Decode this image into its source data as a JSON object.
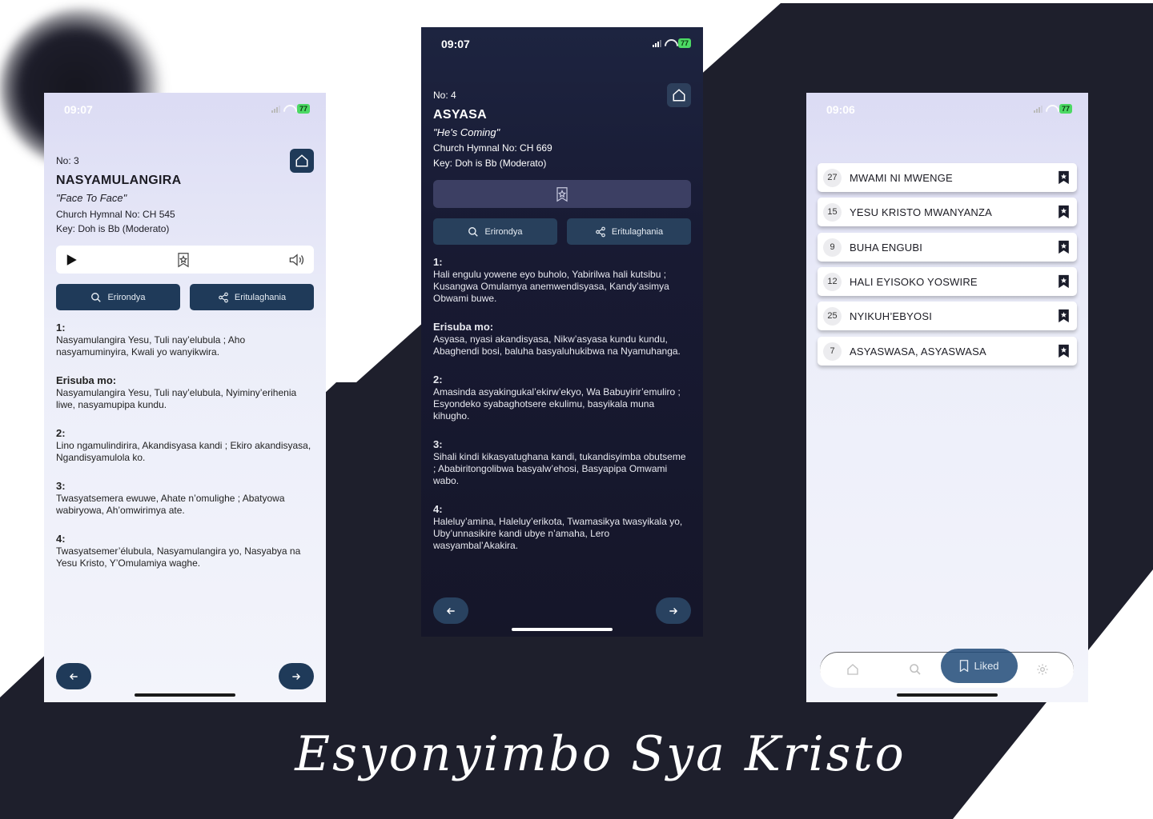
{
  "headline": "Esyonyimbo Sya Kristo",
  "colors": {
    "background_dark": "#1e1f2c",
    "accent": "#1f3a59",
    "battery": "#4cd964"
  },
  "left_screen": {
    "status_time": "09:07",
    "battery": "77",
    "hymn_no": "No: 3",
    "title": "NASYAMULANGIRA",
    "english_title": "\"Face To Face\"",
    "church_hymnal": "Church Hymnal No: CH 545",
    "key": "Key: Doh is Bb (Moderato)",
    "player_icons": [
      "play-icon",
      "bookmark-star-icon",
      "speaker-icon"
    ],
    "search_label": "Erirondya",
    "share_label": "Eritulaghania",
    "verses": [
      {
        "heading": "1:",
        "text": "Nasyamulangira Yesu, Tuli nay’elubula ; Aho nasyamuminyira, Kwali yo wanyikwira."
      },
      {
        "heading": "Erisuba mo:",
        "text": "Nasyamulangira Yesu, Tuli nay’elubula, Nyiminy’erihenia liwe, nasyamupipa kundu."
      },
      {
        "heading": "2:",
        "text": "Lino ngamulindirira, Akandisyasa kandi ; Ekiro akandisyasa, Ngandisyamulola ko."
      },
      {
        "heading": "3:",
        "text": "Twasyatsemera ewuwe, Ahate n’omulighe ; Abatyowa wabiryowa, Ah’omwirimya ate."
      },
      {
        "heading": "4:",
        "text": "Twasyatsemer’élubula, Nasyamulangira yo, Nasyabya na Yesu Kristo, Y’Omulamiya waghe."
      }
    ]
  },
  "center_screen": {
    "status_time": "09:07",
    "battery": "77",
    "hymn_no": "No: 4",
    "title": "ASYASA",
    "english_title": "\"He's Coming\"",
    "church_hymnal": "Church Hymnal No: CH 669",
    "key": "Key: Doh is Bb (Moderato)",
    "search_label": "Erirondya",
    "share_label": "Eritulaghania",
    "verses": [
      {
        "heading": "1:",
        "text": "Hali engulu yowene eyo buholo, Yabirilwa hali kutsibu ; Kusangwa Omulamya anemwendisyasa, Kandy’asimya Obwami buwe."
      },
      {
        "heading": "Erisuba mo:",
        "text": "Asyasa, nyasi akandisyasa, Nikw’asyasa kundu kundu, Abaghendi bosi, baluha basyaluhukibwa na Nyamuhanga."
      },
      {
        "heading": "2:",
        "text": "Amasinda asyakingukal’ekirw’ekyo, Wa Babuyirir’emuliro ; Esyondeko syabaghotsere ekulimu, basyikala muna kihugho."
      },
      {
        "heading": "3:",
        "text": "Sihali kindi kikasyatughana kandi, tukandisyimba obutseme ; Ababiritongolibwa basyalw’ehosi, Basyapipa Omwami wabo."
      },
      {
        "heading": "4:",
        "text": "Haleluy’amina, Haleluy’erikota, Twamasikya twasyikala yo, Uby’unnasikire kandi ubye n’amaha, Lero wasyambal’Akakira."
      }
    ]
  },
  "right_screen": {
    "status_time": "09:06",
    "battery": "77",
    "liked": [
      {
        "number": "27",
        "title": "MWAMI NI MWENGE"
      },
      {
        "number": "15",
        "title": "YESU KRISTO MWANYANZA"
      },
      {
        "number": "9",
        "title": "BUHA ENGUBI"
      },
      {
        "number": "12",
        "title": "HALI EYISOKO YOSWIRE"
      },
      {
        "number": "25",
        "title": "NYIKUH’EBYOSI"
      },
      {
        "number": "7",
        "title": "ASYASWASA, ASYASWASA"
      }
    ],
    "tabs": {
      "active_label": "Liked",
      "icons": [
        "home-icon",
        "search-icon",
        "bookmark-icon",
        "settings-icon"
      ]
    }
  }
}
